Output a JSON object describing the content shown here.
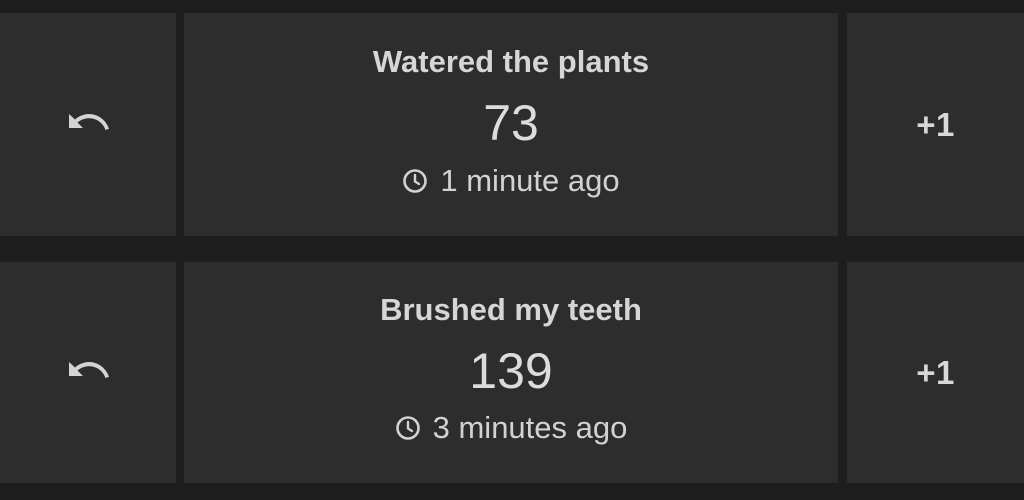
{
  "counters": [
    {
      "title": "Watered the plants",
      "count": "73",
      "last_updated": "1 minute ago",
      "undo_icon": "undo-icon",
      "increment_label": "+1"
    },
    {
      "title": "Brushed my teeth",
      "count": "139",
      "last_updated": "3 minutes ago",
      "undo_icon": "undo-icon",
      "increment_label": "+1"
    }
  ],
  "colors": {
    "background": "#1e1e1e",
    "card": "#2d2d2d",
    "text": "#d2d2d2"
  }
}
